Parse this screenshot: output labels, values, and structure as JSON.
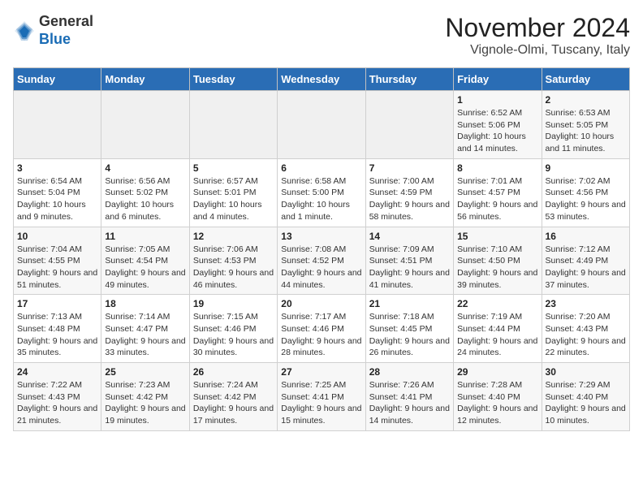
{
  "header": {
    "logo_general": "General",
    "logo_blue": "Blue",
    "month_title": "November 2024",
    "location": "Vignole-Olmi, Tuscany, Italy"
  },
  "columns": [
    "Sunday",
    "Monday",
    "Tuesday",
    "Wednesday",
    "Thursday",
    "Friday",
    "Saturday"
  ],
  "weeks": [
    {
      "days": [
        {
          "num": "",
          "info": ""
        },
        {
          "num": "",
          "info": ""
        },
        {
          "num": "",
          "info": ""
        },
        {
          "num": "",
          "info": ""
        },
        {
          "num": "",
          "info": ""
        },
        {
          "num": "1",
          "info": "Sunrise: 6:52 AM\nSunset: 5:06 PM\nDaylight: 10 hours and 14 minutes."
        },
        {
          "num": "2",
          "info": "Sunrise: 6:53 AM\nSunset: 5:05 PM\nDaylight: 10 hours and 11 minutes."
        }
      ]
    },
    {
      "days": [
        {
          "num": "3",
          "info": "Sunrise: 6:54 AM\nSunset: 5:04 PM\nDaylight: 10 hours and 9 minutes."
        },
        {
          "num": "4",
          "info": "Sunrise: 6:56 AM\nSunset: 5:02 PM\nDaylight: 10 hours and 6 minutes."
        },
        {
          "num": "5",
          "info": "Sunrise: 6:57 AM\nSunset: 5:01 PM\nDaylight: 10 hours and 4 minutes."
        },
        {
          "num": "6",
          "info": "Sunrise: 6:58 AM\nSunset: 5:00 PM\nDaylight: 10 hours and 1 minute."
        },
        {
          "num": "7",
          "info": "Sunrise: 7:00 AM\nSunset: 4:59 PM\nDaylight: 9 hours and 58 minutes."
        },
        {
          "num": "8",
          "info": "Sunrise: 7:01 AM\nSunset: 4:57 PM\nDaylight: 9 hours and 56 minutes."
        },
        {
          "num": "9",
          "info": "Sunrise: 7:02 AM\nSunset: 4:56 PM\nDaylight: 9 hours and 53 minutes."
        }
      ]
    },
    {
      "days": [
        {
          "num": "10",
          "info": "Sunrise: 7:04 AM\nSunset: 4:55 PM\nDaylight: 9 hours and 51 minutes."
        },
        {
          "num": "11",
          "info": "Sunrise: 7:05 AM\nSunset: 4:54 PM\nDaylight: 9 hours and 49 minutes."
        },
        {
          "num": "12",
          "info": "Sunrise: 7:06 AM\nSunset: 4:53 PM\nDaylight: 9 hours and 46 minutes."
        },
        {
          "num": "13",
          "info": "Sunrise: 7:08 AM\nSunset: 4:52 PM\nDaylight: 9 hours and 44 minutes."
        },
        {
          "num": "14",
          "info": "Sunrise: 7:09 AM\nSunset: 4:51 PM\nDaylight: 9 hours and 41 minutes."
        },
        {
          "num": "15",
          "info": "Sunrise: 7:10 AM\nSunset: 4:50 PM\nDaylight: 9 hours and 39 minutes."
        },
        {
          "num": "16",
          "info": "Sunrise: 7:12 AM\nSunset: 4:49 PM\nDaylight: 9 hours and 37 minutes."
        }
      ]
    },
    {
      "days": [
        {
          "num": "17",
          "info": "Sunrise: 7:13 AM\nSunset: 4:48 PM\nDaylight: 9 hours and 35 minutes."
        },
        {
          "num": "18",
          "info": "Sunrise: 7:14 AM\nSunset: 4:47 PM\nDaylight: 9 hours and 33 minutes."
        },
        {
          "num": "19",
          "info": "Sunrise: 7:15 AM\nSunset: 4:46 PM\nDaylight: 9 hours and 30 minutes."
        },
        {
          "num": "20",
          "info": "Sunrise: 7:17 AM\nSunset: 4:46 PM\nDaylight: 9 hours and 28 minutes."
        },
        {
          "num": "21",
          "info": "Sunrise: 7:18 AM\nSunset: 4:45 PM\nDaylight: 9 hours and 26 minutes."
        },
        {
          "num": "22",
          "info": "Sunrise: 7:19 AM\nSunset: 4:44 PM\nDaylight: 9 hours and 24 minutes."
        },
        {
          "num": "23",
          "info": "Sunrise: 7:20 AM\nSunset: 4:43 PM\nDaylight: 9 hours and 22 minutes."
        }
      ]
    },
    {
      "days": [
        {
          "num": "24",
          "info": "Sunrise: 7:22 AM\nSunset: 4:43 PM\nDaylight: 9 hours and 21 minutes."
        },
        {
          "num": "25",
          "info": "Sunrise: 7:23 AM\nSunset: 4:42 PM\nDaylight: 9 hours and 19 minutes."
        },
        {
          "num": "26",
          "info": "Sunrise: 7:24 AM\nSunset: 4:42 PM\nDaylight: 9 hours and 17 minutes."
        },
        {
          "num": "27",
          "info": "Sunrise: 7:25 AM\nSunset: 4:41 PM\nDaylight: 9 hours and 15 minutes."
        },
        {
          "num": "28",
          "info": "Sunrise: 7:26 AM\nSunset: 4:41 PM\nDaylight: 9 hours and 14 minutes."
        },
        {
          "num": "29",
          "info": "Sunrise: 7:28 AM\nSunset: 4:40 PM\nDaylight: 9 hours and 12 minutes."
        },
        {
          "num": "30",
          "info": "Sunrise: 7:29 AM\nSunset: 4:40 PM\nDaylight: 9 hours and 10 minutes."
        }
      ]
    }
  ]
}
